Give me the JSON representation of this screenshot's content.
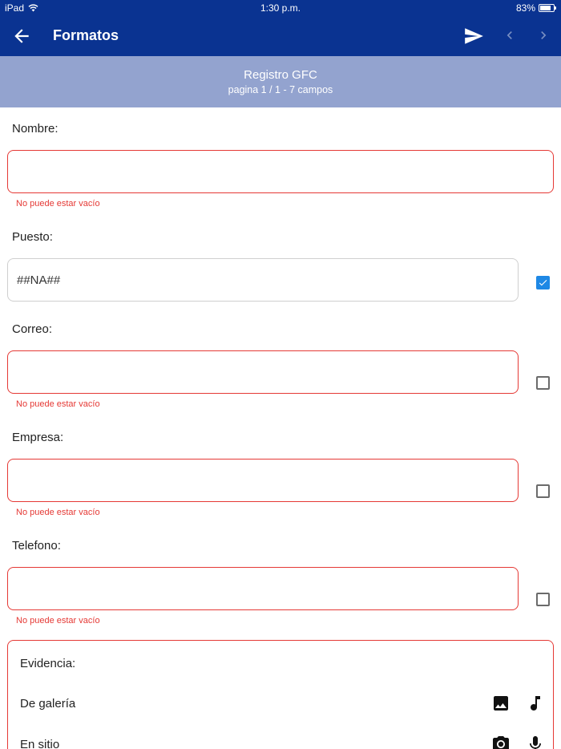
{
  "status_bar": {
    "device": "iPad",
    "time": "1:30 p.m.",
    "battery": "83%",
    "battery_level": 0.83
  },
  "app_bar": {
    "title": "Formatos",
    "icons": {
      "back": "arrow-back-icon",
      "send": "send-icon",
      "prev": "chevron-left-icon",
      "next": "chevron-right-icon"
    }
  },
  "form_header": {
    "title": "Registro GFC",
    "subtitle": "pagina 1 / 1 - 7 campos"
  },
  "fields": [
    {
      "label": "Nombre:",
      "value": "",
      "error": "No puede estar vacío"
    },
    {
      "label": "Puesto:",
      "value": "##NA##",
      "checked": true
    },
    {
      "label": "Correo:",
      "value": "",
      "error": "No puede estar vacío",
      "checked": false
    },
    {
      "label": "Empresa:",
      "value": "",
      "error": "No puede estar vacío",
      "checked": false
    },
    {
      "label": "Telefono:",
      "value": "",
      "error": "No puede estar vacío",
      "checked": false
    }
  ],
  "evidence": {
    "title": "Evidencia:",
    "gallery_label": "De galería",
    "onsite_label": "En sitio",
    "icons": [
      "image-icon",
      "music-note-icon",
      "camera-icon",
      "microphone-icon"
    ]
  },
  "colors": {
    "primary": "#0a3391",
    "header_band": "#93a3cf",
    "error": "#e53935",
    "checkbox": "#1e88e5"
  }
}
